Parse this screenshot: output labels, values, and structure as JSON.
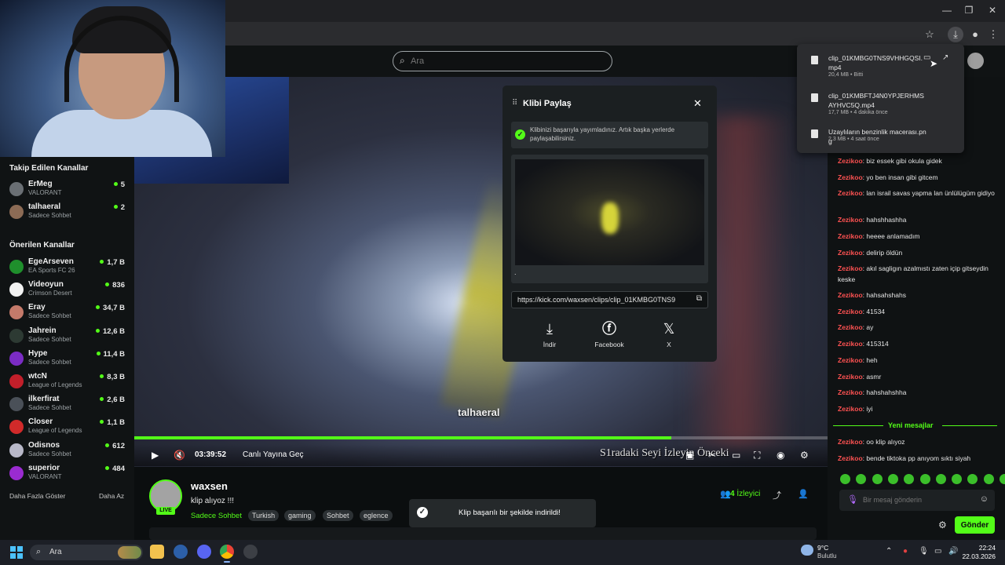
{
  "browser": {
    "window_controls": [
      "—",
      "❐",
      "✕"
    ],
    "toolbar_icons": [
      "star-icon",
      "download-icon",
      "profile-icon",
      "more-icon"
    ]
  },
  "header": {
    "search_placeholder": "Ara"
  },
  "sidebar": {
    "followed_title": "Takip Edilen Kanallar",
    "followed": [
      {
        "name": "ErMeg",
        "game": "VALORANT",
        "count": "5",
        "color": "#6a6f74"
      },
      {
        "name": "talhaeral",
        "game": "Sadece Sohbet",
        "count": "2",
        "color": "#8c6b55"
      }
    ],
    "recommended_title": "Önerilen Kanallar",
    "recommended": [
      {
        "name": "EgeArseven",
        "game": "EA Sports FC 26",
        "count": "1,7 B",
        "color": "#1f8f2c"
      },
      {
        "name": "Videoyun",
        "game": "Crimson Desert",
        "count": "836",
        "color": "#f2f2f2"
      },
      {
        "name": "Eray",
        "game": "Sadece Sohbet",
        "count": "34,7 B",
        "color": "#c47a6a"
      },
      {
        "name": "Jahrein",
        "game": "Sadece Sohbet",
        "count": "12,6 B",
        "color": "#2d3a33"
      },
      {
        "name": "Hype",
        "game": "Sadece Sohbet",
        "count": "11,4 B",
        "color": "#7b2cc4"
      },
      {
        "name": "wtcN",
        "game": "League of Legends",
        "count": "8,3 B",
        "color": "#c21f2a"
      },
      {
        "name": "ilkerfirat",
        "game": "Sadece Sohbet",
        "count": "2,6 B",
        "color": "#4a5058"
      },
      {
        "name": "Closer",
        "game": "League of Legends",
        "count": "1,1 B",
        "color": "#d12a2a"
      },
      {
        "name": "Odisnos",
        "game": "Sadece Sohbet",
        "count": "612",
        "color": "#b8b8c8"
      },
      {
        "name": "superior",
        "game": "VALORANT",
        "count": "484",
        "color": "#9a2bd1"
      }
    ],
    "show_more": "Daha Fazla Göster",
    "show_less": "Daha Az"
  },
  "video": {
    "watermark": "talhaeral",
    "elapsed": "03:39:52",
    "go_live": "Canlı Yayına Geç",
    "progress_fraction": 0.775,
    "overlay_text": "S1radaki Seyi     İzleyin Önceki"
  },
  "stream": {
    "streamer": "waxsen",
    "live": "LIVE",
    "title": "klip alıyoz !!!",
    "category": "Sadece Sohbet",
    "tags": [
      "Turkish",
      "gaming",
      "Sohbet",
      "eglence"
    ],
    "viewers": "4",
    "viewers_label": "İzleyici"
  },
  "toast": {
    "message": "Klip başarılı bir şekilde indirildi!"
  },
  "share_modal": {
    "title": "Klibi Paylaş",
    "success": "Klibinizi başarıyla yayımladınız. Artık başka yerlerde paylaşabilirsiniz.",
    "dot": ".",
    "url": "https://kick.com/waxsen/clips/clip_01KMBG0TNS9",
    "options": [
      {
        "label": "İndir",
        "icon": "download-icon"
      },
      {
        "label": "Facebook",
        "icon": "facebook-icon"
      },
      {
        "label": "X",
        "icon": "x-icon"
      }
    ]
  },
  "downloads": [
    {
      "name": "clip_01KMBG0TNS9VHHGQSI.mp4",
      "meta": "20,4 MB • Bitti"
    },
    {
      "name": "clip_01KMBFTJ4N0YPJERHMSAYHVC5Q.mp4",
      "meta": "17,7 MB • 4 dakika önce"
    },
    {
      "name": "Uzaylıların benzinlik macerası.png",
      "meta": "2,3 MB • 4 saat önce"
    }
  ],
  "chat": {
    "messages": [
      {
        "user": "Zezikoo",
        "text": "biz essek gibi okula gidek"
      },
      {
        "user": "Zezikoo",
        "text": "yo ben insan gibi gitcem"
      },
      {
        "user": "Zezikoo",
        "text": "lan israil savas yapma lan ünlülügüm gidiyo"
      },
      {
        "user": "Zezikoo",
        "text": "hahshhashha"
      },
      {
        "user": "Zezikoo",
        "text": "heeee anlamadım"
      },
      {
        "user": "Zezikoo",
        "text": "delirip öldün"
      },
      {
        "user": "Zezikoo",
        "text": "akıl sagligın azalmıstı zaten içip gitseydin keske"
      },
      {
        "user": "Zezikoo",
        "text": "hahsahshahs"
      },
      {
        "user": "Zezikoo",
        "text": "41534"
      },
      {
        "user": "Zezikoo",
        "text": "ay"
      },
      {
        "user": "Zezikoo",
        "text": "415314"
      },
      {
        "user": "Zezikoo",
        "text": "heh"
      },
      {
        "user": "Zezikoo",
        "text": "asmr"
      },
      {
        "user": "Zezikoo",
        "text": "hahshahshha"
      },
      {
        "user": "Zezikoo",
        "text": "iyi"
      }
    ],
    "new_messages": "Yeni mesajlar",
    "after_messages": [
      {
        "user": "Zezikoo",
        "text": "oo klip alıyoz"
      },
      {
        "user": "Zezikoo",
        "text": "bende tiktoka pp anıyom sıktı siyah"
      }
    ],
    "input_placeholder": "Bir mesaj gönderin",
    "send": "Gönder"
  },
  "taskbar": {
    "search": "Ara",
    "weather_temp": "9°C",
    "weather_desc": "Bulutlu",
    "time": "22:24",
    "date": "22.03.2026",
    "notification_badge": "2"
  }
}
